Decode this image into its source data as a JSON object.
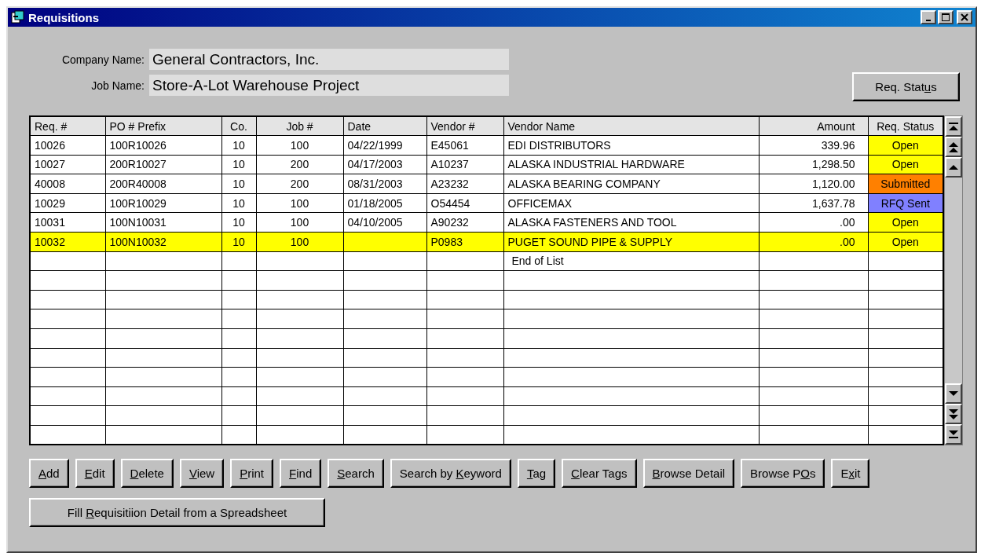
{
  "window": {
    "title": "Requisitions"
  },
  "header": {
    "company_label": "Company Name:",
    "company": "General Contractors, Inc.",
    "job_label": "Job Name:",
    "job": "Store-A-Lot Warehouse Project",
    "status_button": {
      "before": "Req. Stat",
      "key": "u",
      "after": "s"
    }
  },
  "table": {
    "columns": [
      "Req. #",
      "PO # Prefix",
      "Co.",
      "Job #",
      "Date",
      "Vendor #",
      "Vendor Name",
      "Amount",
      "Req. Status"
    ],
    "rows": [
      {
        "selected": false,
        "cells": [
          "10026",
          "100R10026",
          "10",
          "100",
          "04/22/1999",
          "E45061",
          "EDI DISTRIBUTORS",
          "339.96"
        ],
        "status": {
          "text": "Open",
          "color": "#ffff00"
        }
      },
      {
        "selected": false,
        "cells": [
          "10027",
          "200R10027",
          "10",
          "200",
          "04/17/2003",
          "A10237",
          "ALASKA INDUSTRIAL HARDWARE",
          "1,298.50"
        ],
        "status": {
          "text": "Open",
          "color": "#ffff00"
        }
      },
      {
        "selected": false,
        "cells": [
          "40008",
          "200R40008",
          "10",
          "200",
          "08/31/2003",
          "A23232",
          "ALASKA BEARING COMPANY",
          "1,120.00"
        ],
        "status": {
          "text": "Submitted",
          "color": "#ff8000"
        }
      },
      {
        "selected": false,
        "cells": [
          "10029",
          "100R10029",
          "10",
          "100",
          "01/18/2005",
          "O54454",
          "OFFICEMAX",
          "1,637.78"
        ],
        "status": {
          "text": "RFQ Sent",
          "color": "#8080ff"
        }
      },
      {
        "selected": false,
        "cells": [
          "10031",
          "100N10031",
          "10",
          "100",
          "04/10/2005",
          "A90232",
          "ALASKA FASTENERS AND TOOL",
          ".00"
        ],
        "status": {
          "text": "Open",
          "color": "#ffff00"
        }
      },
      {
        "selected": true,
        "cells": [
          "10032",
          "100N10032",
          "10",
          "100",
          "",
          "P0983",
          "PUGET SOUND PIPE & SUPPLY",
          ".00"
        ],
        "status": {
          "text": "Open",
          "color": "#ffff00"
        }
      }
    ],
    "end_text": "End of List"
  },
  "buttons": [
    {
      "key": "A",
      "after": "dd"
    },
    {
      "key": "E",
      "after": "dit"
    },
    {
      "key": "D",
      "after": "elete"
    },
    {
      "key": "V",
      "after": "iew"
    },
    {
      "key": "P",
      "after": "rint"
    },
    {
      "key": "F",
      "after": "ind"
    },
    {
      "key": "S",
      "after": "earch"
    },
    {
      "before": "Search by ",
      "key": "K",
      "after": "eyword"
    },
    {
      "key": "T",
      "after": "ag"
    },
    {
      "key": "C",
      "after": "lear Tags"
    },
    {
      "key": "B",
      "after": "rowse Detail"
    },
    {
      "before": "Browse P",
      "key": "O",
      "after": "s"
    },
    {
      "before": "E",
      "key": "x",
      "after": "it"
    }
  ],
  "fill_button": {
    "before": "Fill ",
    "key": "R",
    "after": "equisitiion Detail from a Spreadsheet"
  }
}
